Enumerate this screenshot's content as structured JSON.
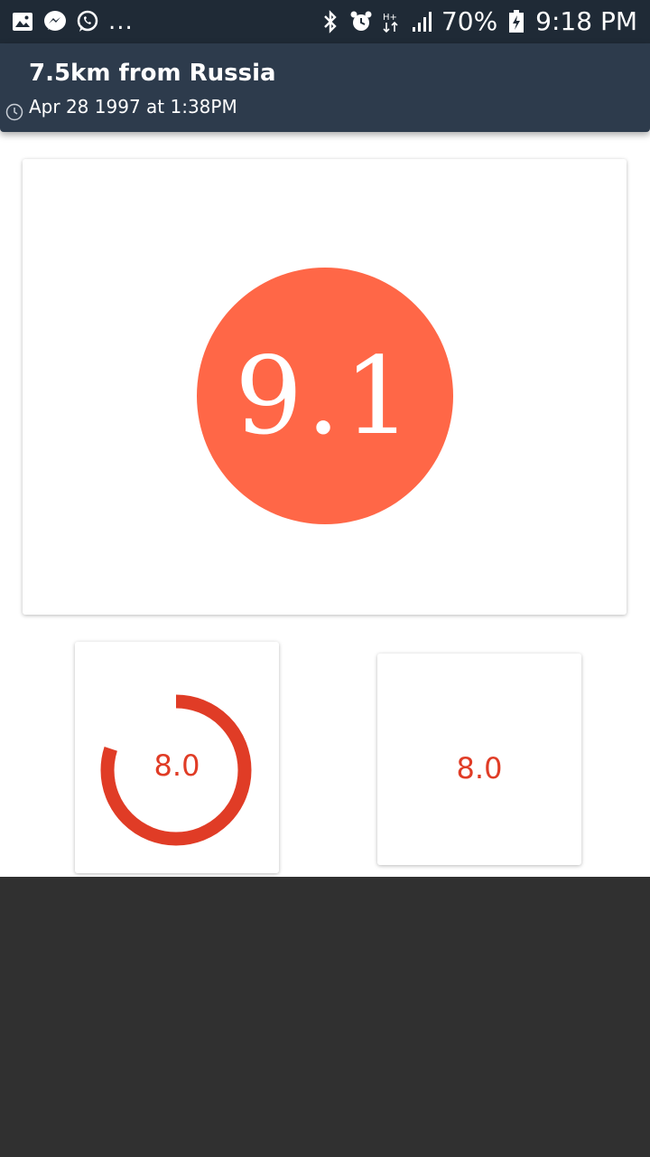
{
  "status_bar": {
    "left_icons": [
      "gallery-icon",
      "messenger-icon",
      "whatsapp-icon"
    ],
    "more_indicator": "...",
    "right_icons": [
      "bluetooth-icon",
      "alarm-icon",
      "data-hplus-icon",
      "signal-icon"
    ],
    "battery_percent": "70%",
    "time": "9:18 PM"
  },
  "header": {
    "title": "7.5km from Russia",
    "subtitle": "Apr 28 1997 at 1:38PM"
  },
  "magnitude": {
    "value_label": "9.1",
    "color": "#ff6747"
  },
  "gauge_card": {
    "value_label": "8.0",
    "progress_fraction": 0.8,
    "color": "#e03c26"
  },
  "plain_card": {
    "value_label": "8.0",
    "color": "#e03c26"
  }
}
